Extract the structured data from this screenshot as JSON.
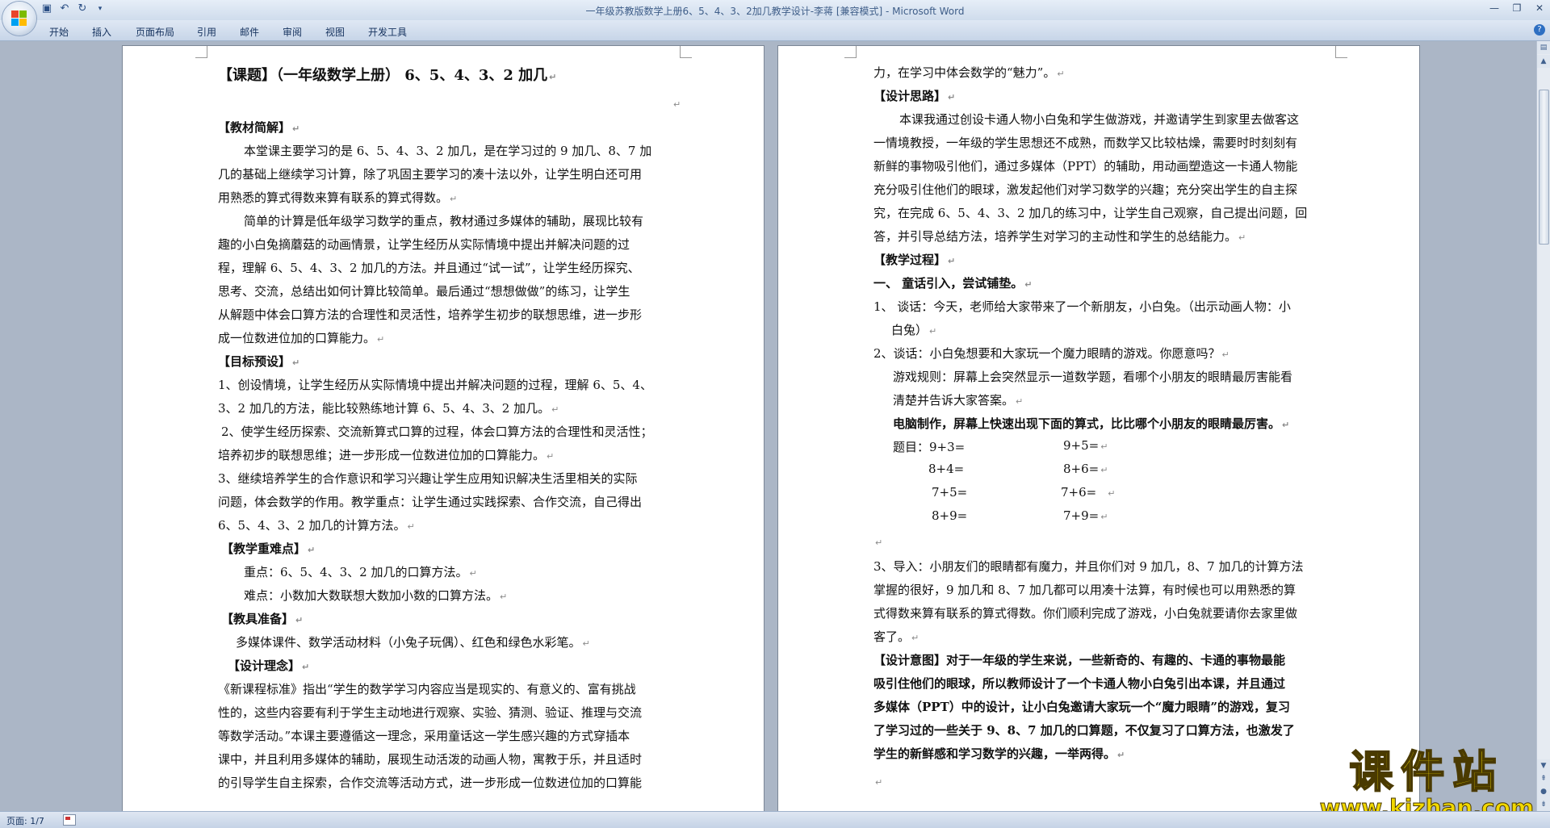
{
  "window": {
    "title": "一年级苏教版数学上册6、5、4、3、2加几教学设计-李蒋 [兼容模式] - Microsoft Word",
    "controls": [
      "—",
      "❐",
      "✕"
    ]
  },
  "quick_access": [
    "save-icon",
    "undo-icon",
    "redo-icon",
    "customize-icon"
  ],
  "ribbon_tabs": [
    "开始",
    "插入",
    "页面布局",
    "引用",
    "邮件",
    "审阅",
    "视图",
    "开发工具"
  ],
  "help": "?",
  "page1": {
    "lines": [
      "【课题】（一年级数学上册） 6、5、4、3、2 加几",
      "【教材简解】",
      "本堂课主要学习的是 6、5、4、3、2 加几，是在学习过的 9 加几、8、7 加",
      "几的基础上继续学习计算，除了巩固主要学习的凑十法以外，让学生明白还可用",
      "用熟悉的算式得数来算有联系的算式得数。",
      "简单的计算是低年级学习数学的重点，教材通过多媒体的辅助，展现比较有",
      "趣的小白兔摘蘑菇的动画情景，让学生经历从实际情境中提出并解决问题的过",
      "程，理解 6、5、4、3、2 加几的方法。并且通过“试一试”，让学生经历探究、",
      "思考、交流，总结出如何计算比较简单。最后通过“想想做做”的练习，让学生",
      "从解题中体会口算方法的合理性和灵活性，培养学生初步的联想思维，进一步形",
      "成一位数进位加的口算能力。",
      "【目标预设】",
      "1、创设情境，让学生经历从实际情境中提出并解决问题的过程，理解 6、5、4、",
      "3、2 加几的方法，能比较熟练地计算 6、5、4、3、2 加几。",
      "2、使学生经历探索、交流新算式口算的过程，体会口算方法的合理性和灵活性；",
      "培养初步的联想思维；进一步形成一位数进位加的口算能力。",
      "3、继续培养学生的合作意识和学习兴趣让学生应用知识解决生活里相关的实际",
      "问题，体会数学的作用。教学重点：让学生通过实践探索、合作交流，自己得出",
      "6、5、4、3、2 加几的计算方法。",
      "【教学重难点】",
      "重点：6、5、4、3、2 加几的口算方法。",
      "难点：小数加大数联想大数加小数的口算方法。",
      "【教具准备】",
      "多媒体课件、数学活动材料（小兔子玩偶）、红色和绿色水彩笔。",
      "【设计理念】",
      "《新课程标准》指出“学生的数学学习内容应当是现实的、有意义的、富有挑战",
      "性的，这些内容要有利于学生主动地进行观察、实验、猜测、验证、推理与交流",
      "等数学活动。”本课主要遵循这一理念，采用童话这一学生感兴趣的方式穿插本",
      "课中，并且利用多媒体的辅助，展现生动活泼的动画人物，寓教于乐，并且适时",
      "的引导学生自主探索，合作交流等活动方式，进一步形成一位数进位加的口算能"
    ]
  },
  "page2": {
    "lines": [
      "力，在学习中体会数学的“魅力”。",
      "【设计思路】",
      "本课我通过创设卡通人物小白兔和学生做游戏，并邀请学生到家里去做客这",
      "一情境教授，一年级的学生思想还不成熟，而数学又比较枯燥，需要时时刻刻有",
      "新鲜的事物吸引他们，通过多媒体（PPT）的辅助，用动画塑造这一卡通人物能",
      "充分吸引住他们的眼球，激发起他们对学习数学的兴趣；充分突出学生的自主探",
      "究，在完成 6、5、4、3、2 加几的练习中，让学生自己观察，自己提出问题，回",
      "答，并引导总结方法，培养学生对学习的主动性和学生的总结能力。",
      "【教学过程】",
      "一、 童话引入，尝试铺垫。",
      "1、 谈话：今天，老师给大家带来了一个新朋友，小白兔。（出示动画人物：小",
      "白兔）",
      "2、谈话：小白兔想要和大家玩一个魔力眼睛的游戏。你愿意吗？",
      "游戏规则：屏幕上会突然显示一道数学题，看哪个小朋友的眼睛最厉害能看",
      "清楚并告诉大家答案。",
      "电脑制作，屏幕上快速出现下面的算式，比比哪个小朋友的眼睛最厉害。",
      "题目：9+3=",
      "9+5=",
      "8+4=",
      "8+6=",
      "7+5=",
      "7+6=",
      "8+9=",
      "7+9=",
      "",
      "3、导入：小朋友们的眼睛都有魔力，并且你们对 9 加几，8、7 加几的计算方法",
      "掌握的很好，9 加几和 8、7 加几都可以用凑十法算，有时候也可以用熟悉的算",
      "式得数来算有联系的算式得数。你们顺利完成了游戏，小白兔就要请你去家里做",
      "客了。",
      "【设计意图】对于一年级的学生来说，一些新奇的、有趣的、卡通的事物最能",
      "吸引住他们的眼球，所以教师设计了一个卡通人物小白兔引出本课，并且通过",
      "多媒体（PPT）中的设计，让小白兔邀请大家玩一个“魔力眼睛”的游戏，复习",
      "了学习过的一些关于 9、8、7 加几的口算题，不仅复习了口算方法，也激发了",
      "学生的新鲜感和学习数学的兴趣，一举两得。"
    ]
  },
  "status": {
    "page_info": "页面: 1/7"
  },
  "watermark": {
    "main": "课件站",
    "url": "www.kjzhan.com"
  }
}
